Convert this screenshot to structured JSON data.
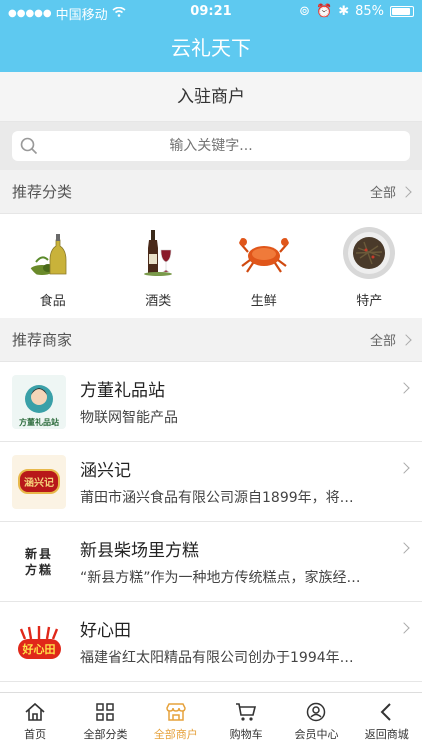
{
  "status": {
    "carrier": "中国移动",
    "time": "09:21",
    "battery": "85%"
  },
  "app": {
    "title": "云礼天下"
  },
  "page": {
    "title": "入驻商户"
  },
  "search": {
    "placeholder": "输入关键字..."
  },
  "recommended_categories": {
    "title": "推荐分类",
    "more": "全部",
    "items": [
      {
        "label": "食品",
        "icon": "olive-oil-icon"
      },
      {
        "label": "酒类",
        "icon": "wine-bottle-icon"
      },
      {
        "label": "生鲜",
        "icon": "crab-icon"
      },
      {
        "label": "特产",
        "icon": "dried-food-plate-icon"
      }
    ]
  },
  "recommended_merchants": {
    "title": "推荐商家",
    "more": "全部",
    "items": [
      {
        "name": "方董礼品站",
        "desc": "物联网智能产品",
        "logo_text": "方董礼品站"
      },
      {
        "name": "涵兴记",
        "desc": "莆田市涵兴食品有限公司源自1899年，将…",
        "logo_text": "涵兴记"
      },
      {
        "name": "新县柴场里方糕",
        "desc": "“新县方糕”作为一种地方传统糕点，家族经…",
        "logo_text": "新县方糕"
      },
      {
        "name": "好心田",
        "desc": "福建省红太阳精品有限公司创办于1994年…",
        "logo_text": "好心田"
      }
    ]
  },
  "tabbar": {
    "items": [
      {
        "label": "首页",
        "icon": "home-icon"
      },
      {
        "label": "全部分类",
        "icon": "grid-icon"
      },
      {
        "label": "全部商户",
        "icon": "store-icon",
        "active": true
      },
      {
        "label": "购物车",
        "icon": "cart-icon"
      },
      {
        "label": "会员中心",
        "icon": "user-icon"
      },
      {
        "label": "返回商城",
        "icon": "back-icon"
      }
    ]
  },
  "colors": {
    "primary": "#5ec9f0",
    "active_tab": "#e6a23c"
  }
}
